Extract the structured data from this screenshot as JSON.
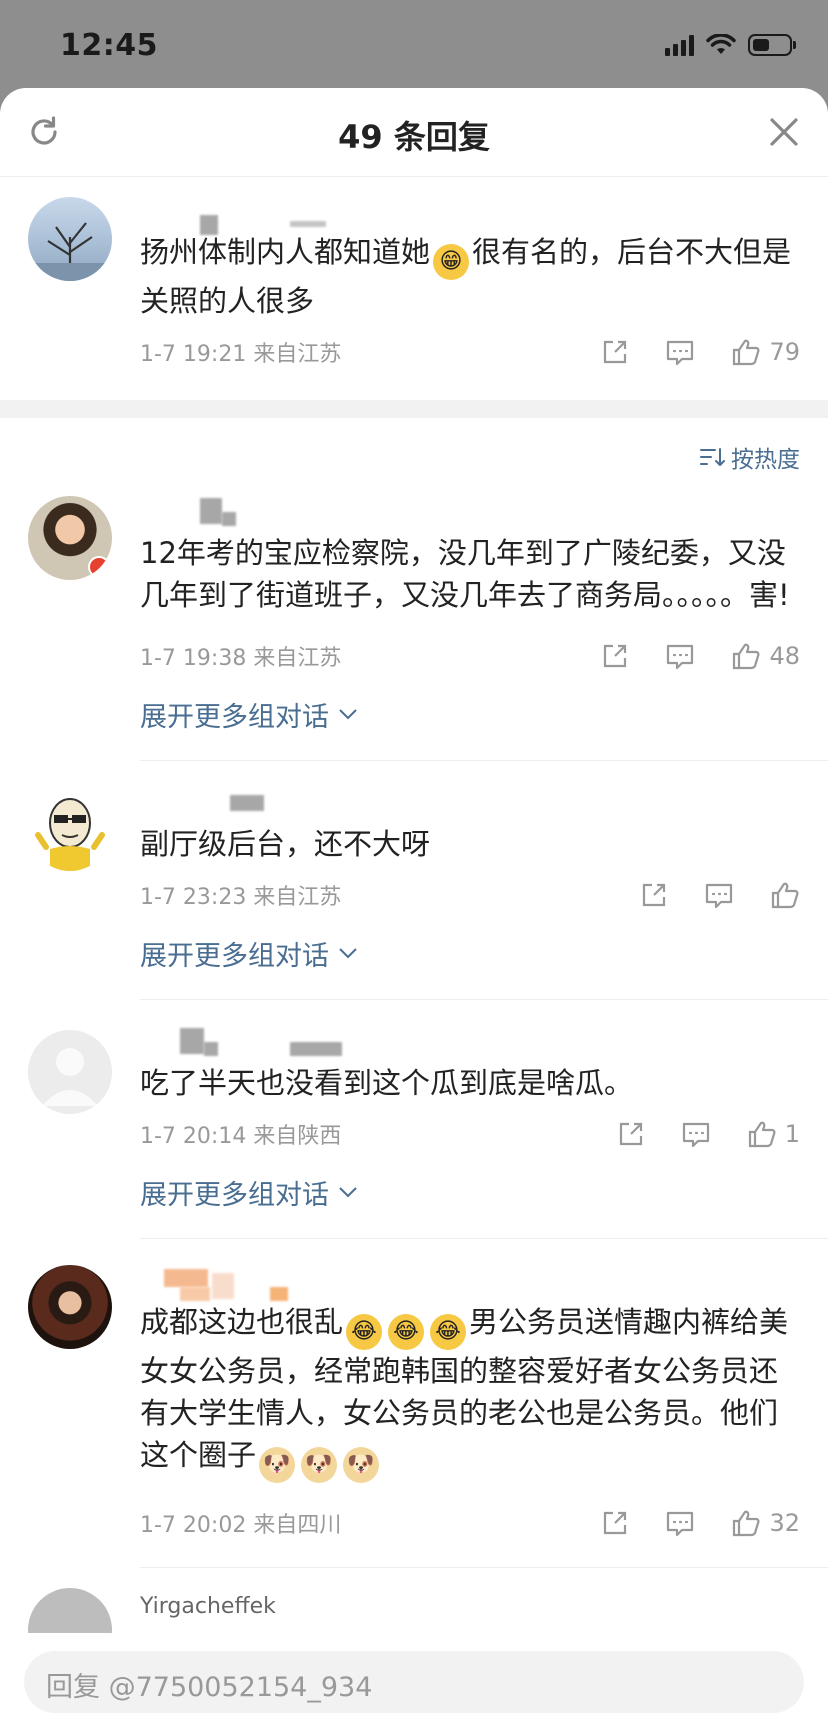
{
  "status_bar": {
    "time": "12:45"
  },
  "sheet": {
    "title": "49 条回复"
  },
  "top_comment": {
    "content": [
      "扬州体制内人都知道她",
      "很有名的，后台不大但是关照的人很多"
    ],
    "meta": "1-7 19:21 来自江苏",
    "likes": "79"
  },
  "sort": {
    "label": "按热度"
  },
  "comments": [
    {
      "content": "12年考的宝应检察院，没几年到了广陵纪委，又没几年到了街道班子，又没几年去了商务局。。。。。害!",
      "meta": "1-7 19:38 来自江苏",
      "likes": "48",
      "expand": "展开更多组对话"
    },
    {
      "content": "副厅级后台，还不大呀",
      "meta": "1-7 23:23 来自江苏",
      "likes": "",
      "expand": "展开更多组对话"
    },
    {
      "content": "吃了半天也没看到这个瓜到底是啥瓜。",
      "meta": "1-7 20:14 来自陕西",
      "likes": "1",
      "expand": "展开更多组对话"
    },
    {
      "content_a": "成都这边也很乱",
      "content_b": "男公务员送情趣内裤给美女女公务员，经常跑韩国的整容爱好者女公务员还有大学生情人，女公务员的老公也是公务员。他们这个圈子",
      "meta": "1-7 20:02 来自四川",
      "likes": "32"
    },
    {
      "username": "Yirgacheffek"
    }
  ],
  "reply": {
    "placeholder": "回复 @7750052154_934"
  },
  "colors": {
    "link": "#4a6e92",
    "meta": "#999999",
    "text": "#222222"
  },
  "icons": [
    "refresh-icon",
    "close-icon",
    "share-icon",
    "comment-icon",
    "like-icon",
    "sort-icon",
    "chevron-down-icon"
  ]
}
